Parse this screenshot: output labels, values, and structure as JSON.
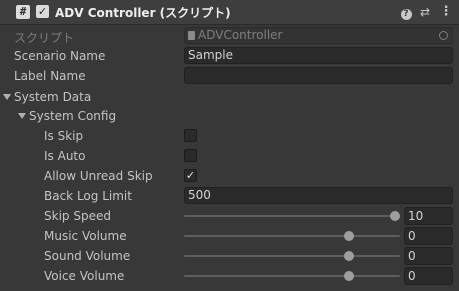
{
  "header": {
    "component_icon_glyph": "#",
    "enabled": true,
    "title": "ADV Controller (スクリプト)",
    "icons": [
      "help-icon",
      "preset-icon",
      "menu-icon"
    ]
  },
  "script_row": {
    "label": "スクリプト",
    "value": "ADVController"
  },
  "scenario_name": {
    "label": "Scenario Name",
    "value": "Sample"
  },
  "label_name": {
    "label": "Label Name",
    "value": ""
  },
  "system_data": {
    "label": "System Data",
    "expanded": true
  },
  "system_config": {
    "label": "System Config",
    "expanded": true
  },
  "is_skip": {
    "label": "Is Skip",
    "checked": false
  },
  "is_auto": {
    "label": "Is Auto",
    "checked": false
  },
  "allow_unread_skip": {
    "label": "Allow Unread Skip",
    "checked": true,
    "check_glyph": "✓"
  },
  "back_log_limit": {
    "label": "Back Log Limit",
    "value": "500"
  },
  "sliders": [
    {
      "label": "Skip Speed",
      "value": "10",
      "fraction": 1.0
    },
    {
      "label": "Music Volume",
      "value": "0",
      "fraction": 0.78
    },
    {
      "label": "Sound Volume",
      "value": "0",
      "fraction": 0.78
    },
    {
      "label": "Voice Volume",
      "value": "0",
      "fraction": 0.78
    }
  ]
}
